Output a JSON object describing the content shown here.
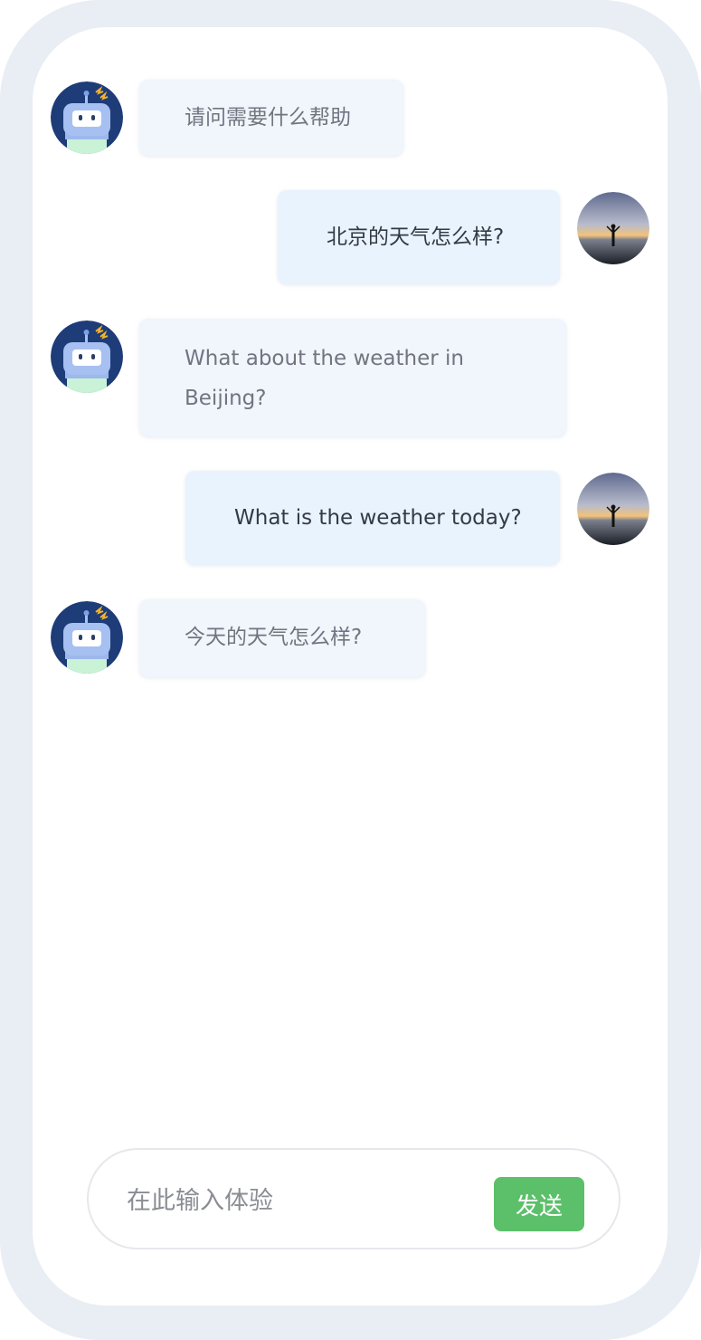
{
  "messages": [
    {
      "role": "bot",
      "text": "请问需要什么帮助"
    },
    {
      "role": "user",
      "text": "北京的天气怎么样?"
    },
    {
      "role": "bot",
      "text_line1": "What about the weather in",
      "text_line2": "Beijing?"
    },
    {
      "role": "user",
      "text": "What is the weather today?"
    },
    {
      "role": "bot",
      "text": "今天的天气怎么样?"
    }
  ],
  "composer": {
    "placeholder": "在此输入体验",
    "send_label": "发送"
  },
  "colors": {
    "frame": "#e9edf4",
    "bot_bubble": "#f1f5fc",
    "user_bubble": "#e9f3fd",
    "send_button": "#5cbf6a"
  },
  "icons": {
    "bot_avatar": "robot-avatar-icon",
    "user_avatar": "user-photo-avatar"
  }
}
